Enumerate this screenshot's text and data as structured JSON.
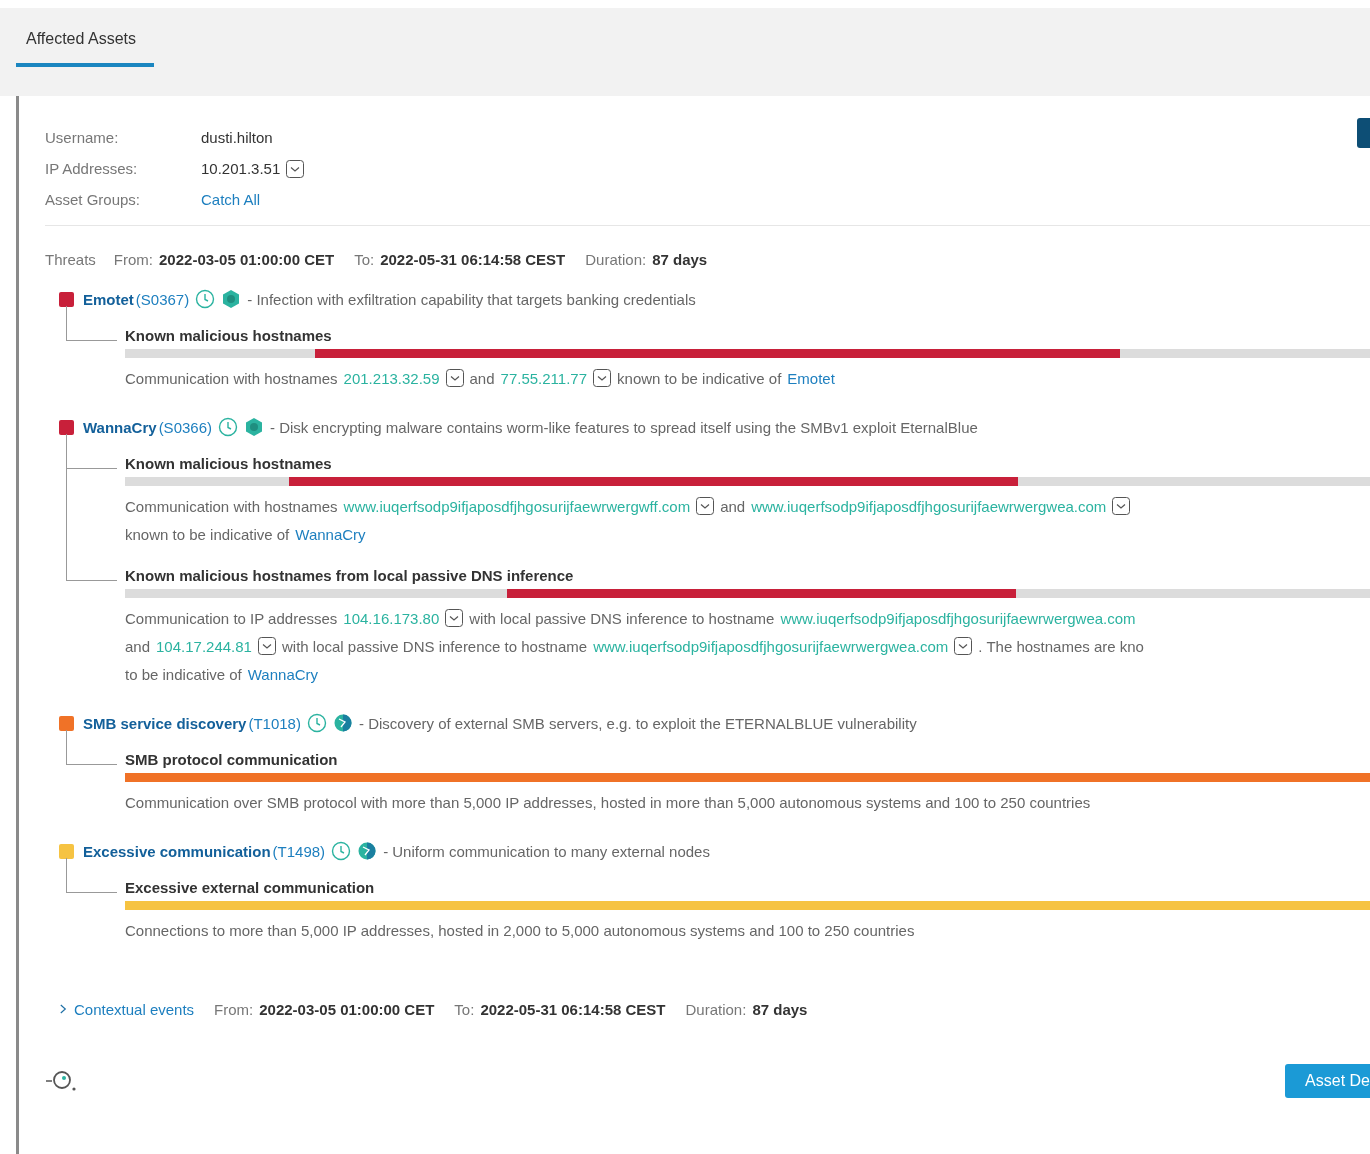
{
  "tabs": [
    {
      "label": "Affected Assets",
      "selected": true
    }
  ],
  "asset": {
    "fields": [
      {
        "label": "Username:",
        "value": "dusti.hilton",
        "kind": "text"
      },
      {
        "label": "IP Addresses:",
        "value": "10.201.3.51",
        "kind": "dropdown"
      },
      {
        "label": "Asset Groups:",
        "value": "Catch All",
        "kind": "link"
      }
    ]
  },
  "threats": {
    "title": "Threats",
    "period": {
      "from_label": "From:",
      "from": "2022-03-05 01:00:00 CET",
      "to_label": "To:",
      "to": "2022-05-31 06:14:58 CEST",
      "duration_label": "Duration:",
      "duration": "87 days"
    },
    "items": [
      {
        "name": "Emotet",
        "code": "(S0367)",
        "kind": "malware",
        "color": "#c8203a",
        "description": "- Infection with exfiltration capability that targets banking credentials",
        "findings": [
          {
            "title": "Known malicious hostnames",
            "lead": {
              "level": 0.153
            },
            "level": 0.799,
            "lines": [
              [
                {
                  "kind": "text",
                  "text": "Communication with hostnames"
                },
                {
                  "kind": "address",
                  "text": "201.213.32.59"
                },
                {
                  "kind": "text",
                  "text": "and"
                },
                {
                  "kind": "address",
                  "text": "77.55.211.77"
                },
                {
                  "kind": "text",
                  "text": "known to be indicative of"
                },
                {
                  "kind": "link",
                  "text": "Emotet"
                }
              ]
            ]
          }
        ]
      },
      {
        "name": "WannaCry",
        "code": "(S0366)",
        "kind": "malware",
        "color": "#c8203a",
        "description": "- Disk encrypting malware contains worm-like features to spread itself using the SMBv1 exploit EternalBlue",
        "findings": [
          {
            "title": "Known malicious hostnames",
            "lead": {
              "level": 0.132
            },
            "level": 0.717,
            "lines": [
              [
                {
                  "kind": "text",
                  "text": "Communication with hostnames"
                },
                {
                  "kind": "address",
                  "text": "www.iuqerfsodp9ifjaposdfjhgosurijfaewrwergwff.com"
                },
                {
                  "kind": "text",
                  "text": "and"
                },
                {
                  "kind": "address",
                  "text": "www.iuqerfsodp9ifjaposdfjhgosurijfaewrwergwea.com"
                }
              ],
              [
                {
                  "kind": "text",
                  "text": "known to be indicative of"
                },
                {
                  "kind": "link",
                  "text": "WannaCry"
                }
              ]
            ]
          },
          {
            "title": "Known malicious hostnames from local passive DNS inference",
            "lead": {
              "level": 0.307
            },
            "level": 0.716,
            "lines": [
              [
                {
                  "kind": "text",
                  "text": "Communication to IP addresses"
                },
                {
                  "kind": "address",
                  "text": "104.16.173.80"
                },
                {
                  "kind": "text",
                  "text": "with local passive DNS inference to hostname"
                },
                {
                  "kind": "plain_address",
                  "text": "www.iuqerfsodp9ifjaposdfjhgosurijfaewrwergwea.com"
                }
              ],
              [
                {
                  "kind": "text",
                  "text": "and"
                },
                {
                  "kind": "address",
                  "text": "104.17.244.81"
                },
                {
                  "kind": "text",
                  "text": "with local passive DNS inference to hostname"
                },
                {
                  "kind": "address",
                  "text": "www.iuqerfsodp9ifjaposdfjhgosurijfaewrwergwea.com"
                },
                {
                  "kind": "text",
                  "text": ". The hostnames are kno"
                }
              ],
              [
                {
                  "kind": "text",
                  "text": "to be indicative of"
                },
                {
                  "kind": "link",
                  "text": "WannaCry"
                }
              ]
            ]
          }
        ]
      },
      {
        "name": "SMB service discovery",
        "code": "(T1018)",
        "kind": "technique",
        "color": "#f07227",
        "description": "- Discovery of external SMB servers, e.g. to exploit the ETERNALBLUE vulnerability",
        "findings": [
          {
            "title": "SMB protocol communication",
            "level": 1,
            "lines": [
              [
                {
                  "kind": "text",
                  "text": "Communication over SMB protocol with more than 5,000 IP addresses, hosted in more than 5,000 autonomous systems and 100 to 250 countries"
                }
              ]
            ]
          }
        ]
      },
      {
        "name": "Excessive communication",
        "code": "(T1498)",
        "kind": "technique",
        "color": "#f6c342",
        "description": "- Uniform communication to many external nodes",
        "findings": [
          {
            "title": "Excessive external communication",
            "level": 1,
            "lines": [
              [
                {
                  "kind": "text",
                  "text": "Connections to more than 5,000 IP addresses, hosted in 2,000 to 5,000 autonomous systems and 100 to 250 countries"
                }
              ]
            ]
          }
        ]
      }
    ]
  },
  "contextual_events": {
    "label": "Contextual events",
    "expanded": false,
    "period": {
      "from_label": "From:",
      "from": "2022-03-05 01:00:00 CET",
      "to_label": "To:",
      "to": "2022-05-31 06:14:58 CEST",
      "duration_label": "Duration:",
      "duration": "87 days"
    }
  },
  "footer": {
    "button": "Asset De"
  }
}
